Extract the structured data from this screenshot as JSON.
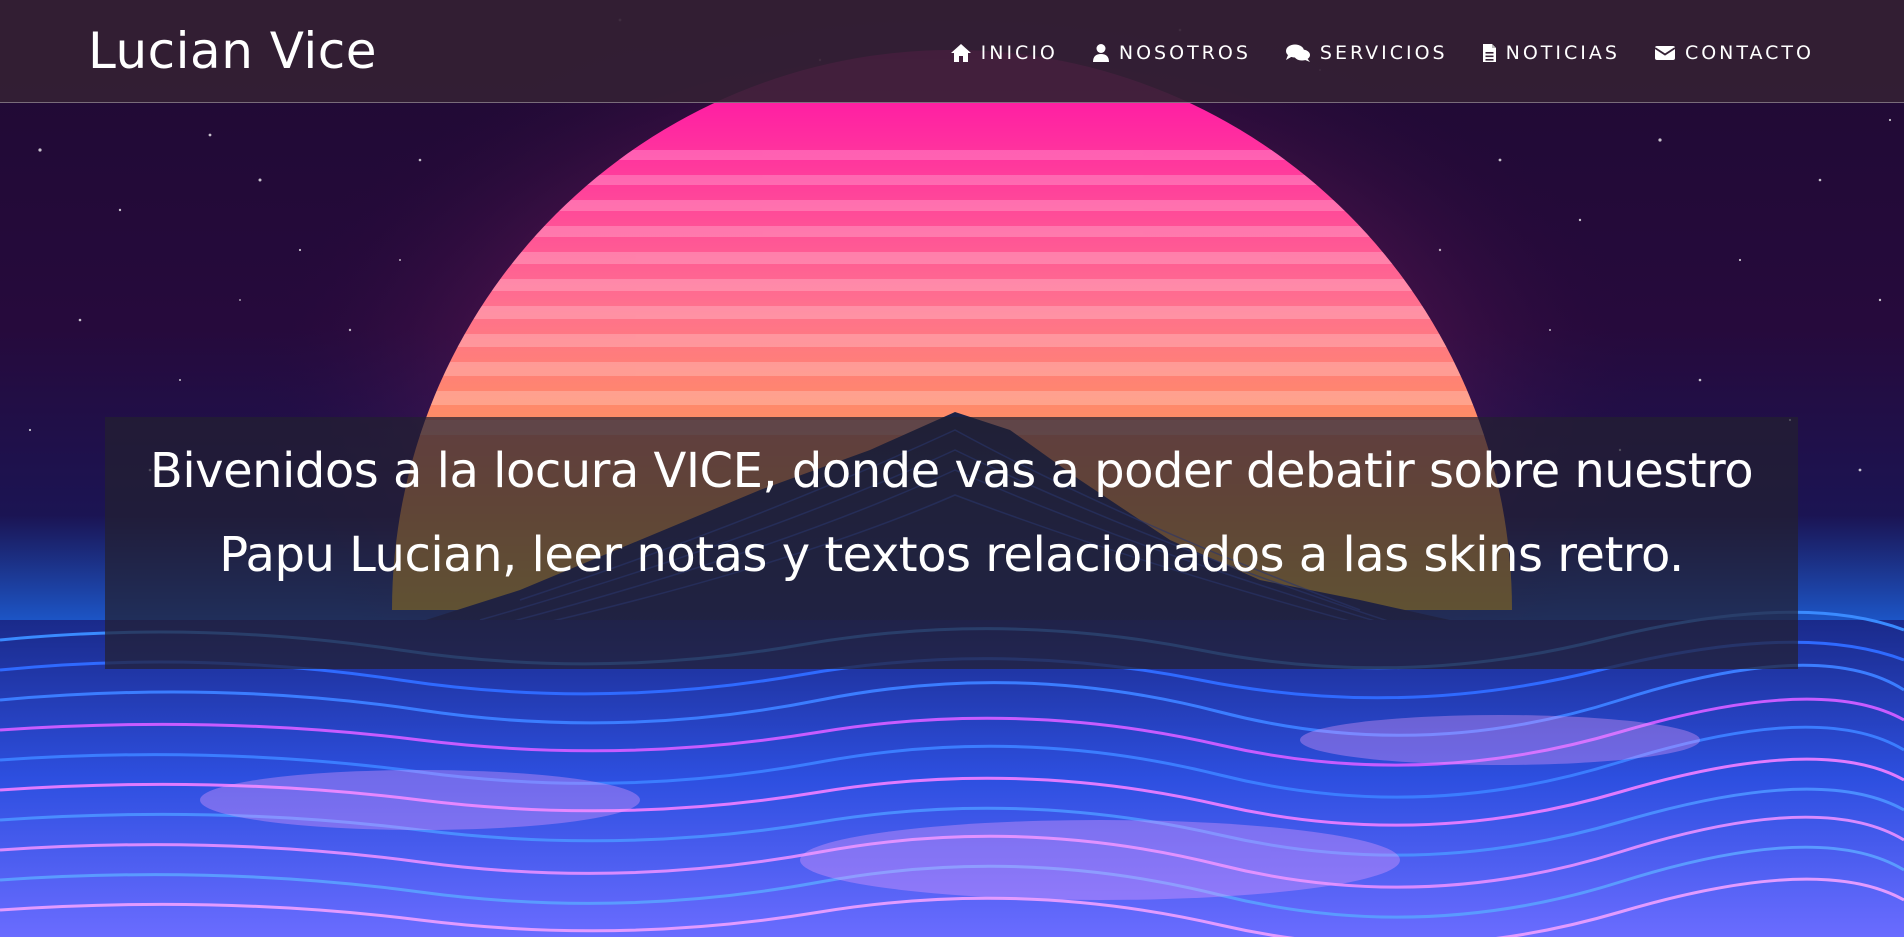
{
  "brand": {
    "title": "Lucian Vice"
  },
  "nav": {
    "items": [
      {
        "label": "INICIO",
        "icon": "home-icon"
      },
      {
        "label": "NOSOTROS",
        "icon": "user-icon"
      },
      {
        "label": "SERVICIOS",
        "icon": "comments-icon"
      },
      {
        "label": "NOTICIAS",
        "icon": "document-icon"
      },
      {
        "label": "CONTACTO",
        "icon": "envelope-icon"
      }
    ]
  },
  "hero": {
    "text": "Bivenidos a la locura VICE, donde vas a poder debatir sobre nuestro Papu Lucian, leer notas y textos relacionados a las skins retro."
  },
  "colors": {
    "navbar_bg": "#342034",
    "sky_top": "#1a0830",
    "sun_top": "#ff0fa8",
    "sun_bottom": "#ffb04a",
    "waves": "#2a6bff",
    "waves_pink": "#d86bff"
  }
}
